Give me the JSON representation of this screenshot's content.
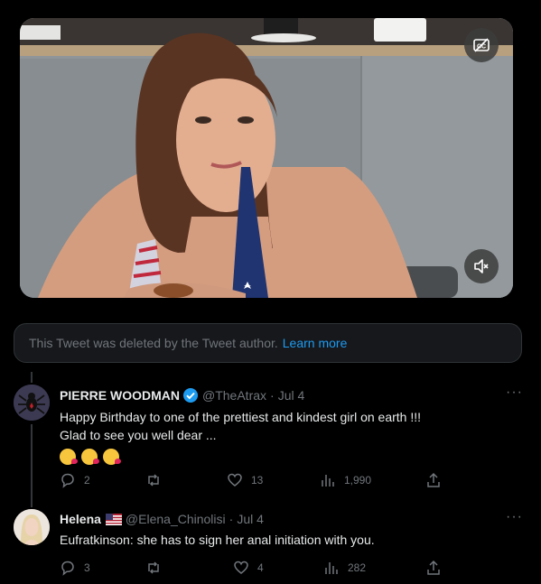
{
  "deleted_notice": {
    "text": "This Tweet was deleted by the Tweet author.",
    "link": "Learn more"
  },
  "tweets": [
    {
      "name": "PIERRE WOODMAN",
      "verified": true,
      "handle": "@TheAtrax",
      "date": "Jul 4",
      "text_line1": "Happy Birthday to one of the prettiest and kindest girl on earth !!!",
      "text_line2": "Glad to see you well dear ...",
      "emojis": [
        "kissing-face-heart",
        "kissing-face-heart",
        "kissing-face-heart"
      ],
      "replies": "2",
      "retweets": "",
      "likes": "13",
      "views": "1,990"
    },
    {
      "name": "Helena",
      "flag": "us-flag",
      "handle": "@Elena_Chinolisi",
      "date": "Jul 4",
      "text_line1": "Eufratkinson: she has to sign her anal initiation with you.",
      "replies": "3",
      "retweets": "",
      "likes": "4",
      "views": "282"
    }
  ],
  "colors": {
    "accent": "#1d9bf0",
    "muted": "#71767b",
    "border": "#2f3336",
    "verified": "#1d9bf0"
  }
}
